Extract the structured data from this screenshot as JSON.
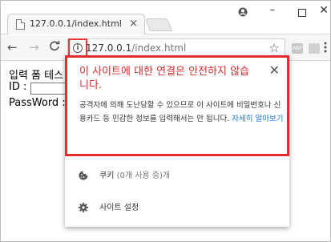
{
  "tab": {
    "title": "127.0.0.1/index.html",
    "close": "×"
  },
  "window_controls": {
    "minimize": "–",
    "close": "✕"
  },
  "toolbar": {
    "back": "←",
    "forward": "→",
    "reload": "C",
    "info": "i",
    "url_host": "127.0.0.1",
    "url_path": "/index.html",
    "star": "☆",
    "ext_label": "ABP",
    "menu": "⋮"
  },
  "page": {
    "title_partial": "입력 폼 테스",
    "id_label": "ID :",
    "pw_label": "PassWord :"
  },
  "popup": {
    "close": "✕",
    "heading": "이 사이트에 대한 연결은 안전하지 않습니다.",
    "description": "공격자에 의해 도난당할 수 있으므로 이 사이트에 비밀번호나 신용카드 등 민감한 정보를 입력해서는 안 됩니다.",
    "link": "자세히 알아보기",
    "cookies_label": "쿠키",
    "cookies_detail": "(0개 사용 중)개",
    "site_settings_label": "사이트 설정"
  },
  "colors": {
    "warning_red": "#d32f2f",
    "highlight_border": "#e12d2d",
    "link_blue": "#1a73e8"
  },
  "icons": {
    "info": "info-icon",
    "cookie": "cookie-icon",
    "settings": "gear-icon",
    "profile": "profile-icon",
    "star": "star-icon"
  }
}
